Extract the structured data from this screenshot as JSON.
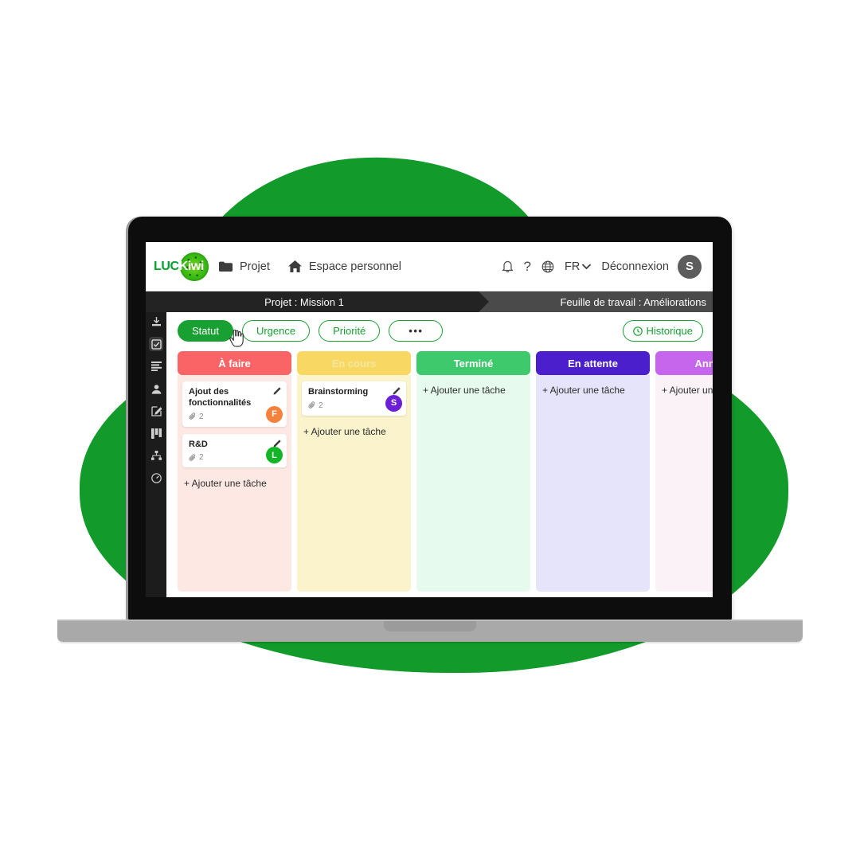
{
  "brand": {
    "logo_prefix": "LUC",
    "logo_suffix": "Kiwi",
    "green": "#19A033"
  },
  "topbar": {
    "nav": [
      {
        "label": "Projet",
        "icon": "folder-icon"
      },
      {
        "label": "Espace personnel",
        "icon": "home-icon"
      }
    ],
    "icons": [
      "bell-icon",
      "help-icon",
      "globe-icon"
    ],
    "language": "FR",
    "logout_label": "Déconnexion",
    "avatar_initial": "S"
  },
  "strip": {
    "project": "Projet : Mission 1",
    "worksheet": "Feuille de travail : Améliorations"
  },
  "sidebar": {
    "items": [
      {
        "name": "import-icon",
        "active": false
      },
      {
        "name": "checklist-icon",
        "active": true
      },
      {
        "name": "list-icon",
        "active": false
      },
      {
        "name": "user-icon",
        "active": false
      },
      {
        "name": "edit-icon",
        "active": false
      },
      {
        "name": "kanban-icon",
        "active": false
      },
      {
        "name": "org-chart-icon",
        "active": false
      },
      {
        "name": "gauge-icon",
        "active": false
      }
    ]
  },
  "filters": {
    "items": [
      {
        "label": "Statut",
        "active": true
      },
      {
        "label": "Urgence",
        "active": false
      },
      {
        "label": "Priorité",
        "active": false
      },
      {
        "label": "•••",
        "active": false,
        "dots": true
      }
    ],
    "history_label": "Historique",
    "history_icon": "clock-icon"
  },
  "board": {
    "add_task_label": "+ Ajouter une tâche",
    "columns": [
      {
        "title": "À faire",
        "head_color": "#FA6466",
        "body_color": "#FDE8E4",
        "title_color": "#ffffff",
        "cards": [
          {
            "title": "Ajout des fonctionnalités",
            "attachments": "2",
            "avatar": "F",
            "avatar_color": "#F5823C"
          },
          {
            "title": "R&D",
            "attachments": "2",
            "avatar": "L",
            "avatar_color": "#11B525"
          }
        ]
      },
      {
        "title": "En cours",
        "head_color": "#F8D863",
        "body_color": "#FAF3CC",
        "title_color": "#F3E7A0",
        "cards": [
          {
            "title": "Brainstorming",
            "attachments": "2",
            "avatar": "S",
            "avatar_color": "#6B1FD6"
          }
        ]
      },
      {
        "title": "Terminé",
        "head_color": "#3FC96D",
        "body_color": "#E6FBEE",
        "title_color": "#ffffff",
        "cards": []
      },
      {
        "title": "En attente",
        "head_color": "#4B1FCC",
        "body_color": "#E6E4FB",
        "title_color": "#ffffff",
        "cards": []
      },
      {
        "title": "Annulé",
        "head_color": "#C566EC",
        "body_color": "#FAF2F7",
        "title_color": "#ffffff",
        "cards": []
      }
    ]
  }
}
